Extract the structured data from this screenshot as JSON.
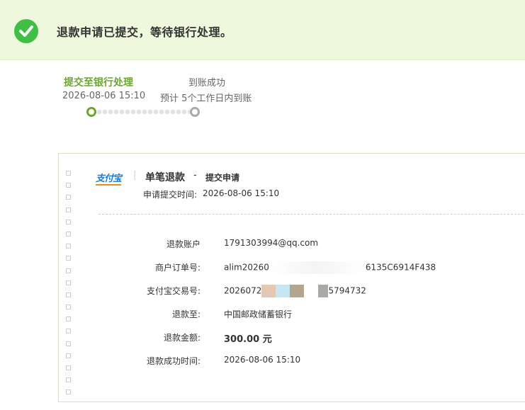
{
  "banner": {
    "message": "退款申请已提交，等待银行处理。"
  },
  "progress": {
    "steps": [
      {
        "title": "提交至银行处理",
        "detail": "2026-08-06 15:10",
        "state": "done"
      },
      {
        "title": "到账成功",
        "detail": "预计 5个工作日内到账",
        "state": "pending"
      }
    ]
  },
  "card": {
    "logo_text": "支付宝",
    "title": "单笔退款",
    "dash": "-",
    "subtitle": "提交申请",
    "apply_time_label": "申请提交时间:",
    "apply_time_value": "2026-08-06 15:10",
    "rows": [
      {
        "label": "退款账户",
        "colon": ":",
        "value": "1791303994@qq.com"
      },
      {
        "label": "商户订单号:",
        "colon": "",
        "value_prefix": "alim20260",
        "value_suffix": "6135C6914F438"
      },
      {
        "label": "支付宝交易号:",
        "colon": "",
        "value_prefix": "2026072",
        "value_suffix": "5794732"
      },
      {
        "label": "退款至:",
        "colon": "",
        "value": "中国邮政储蓄银行"
      },
      {
        "label": "退款金额:",
        "colon": "",
        "value": "300.00 元"
      },
      {
        "label": "退款成功时间:",
        "colon": "",
        "value": "2026-08-06 15:10"
      }
    ]
  },
  "colors": {
    "accent_green": "#6aa82d",
    "success_icon": "#3fbf43",
    "banner_bg": "#eef8dd"
  }
}
